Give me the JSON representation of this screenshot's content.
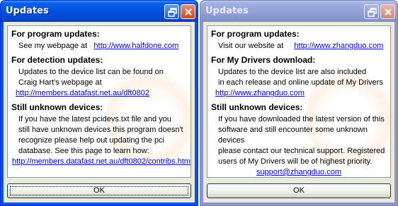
{
  "colors": {
    "active_titlebar": "#0054e3",
    "inactive_titlebar": "#8a97c8",
    "link": "#0000ff",
    "dialog_bg": "#ece9d8"
  },
  "icons": {
    "restore": "restore-icon",
    "close": "close-icon"
  },
  "left": {
    "title": "Updates",
    "h1": "For program updates:",
    "prog_text": "See my webpage at",
    "prog_link": "http://www.halfdone.com",
    "h2": "For detection updates:",
    "det_lines": [
      "Updates to the device list can be found on",
      "Craig Hart's webpage at"
    ],
    "det_link": "http://members.datafast.net.au/dft0802",
    "h3": "Still unknown devices:",
    "unk_lines": [
      "If you have the latest pcidevs.txt file and you",
      "still have unknown devices this program doesn't",
      "recognize please help out updating the pci",
      "database. See this page to learn how:"
    ],
    "unk_link": "http://members.datafast.net.au/dft0802/contribs.htm",
    "ok": "OK"
  },
  "right": {
    "title": "Updates",
    "h1": "For program updates:",
    "prog_text": "Visit our website at",
    "prog_link": "http://www.zhangduo.com",
    "h2": "For My Drivers download:",
    "dl_lines": [
      "Updates to the device list are also included",
      "in each release and online update of My Drivers"
    ],
    "dl_link": "http://www.zhangduo.com",
    "h3": "Still unknown devices:",
    "unk_lines": [
      "If you have downloaded the latest version of this",
      "software and still encounter some unknown devices",
      "please contact our technical support. Registered",
      "users of My Drivers will be of highest priority."
    ],
    "unk_link": "support@zhangduo.com",
    "ok": "OK"
  }
}
